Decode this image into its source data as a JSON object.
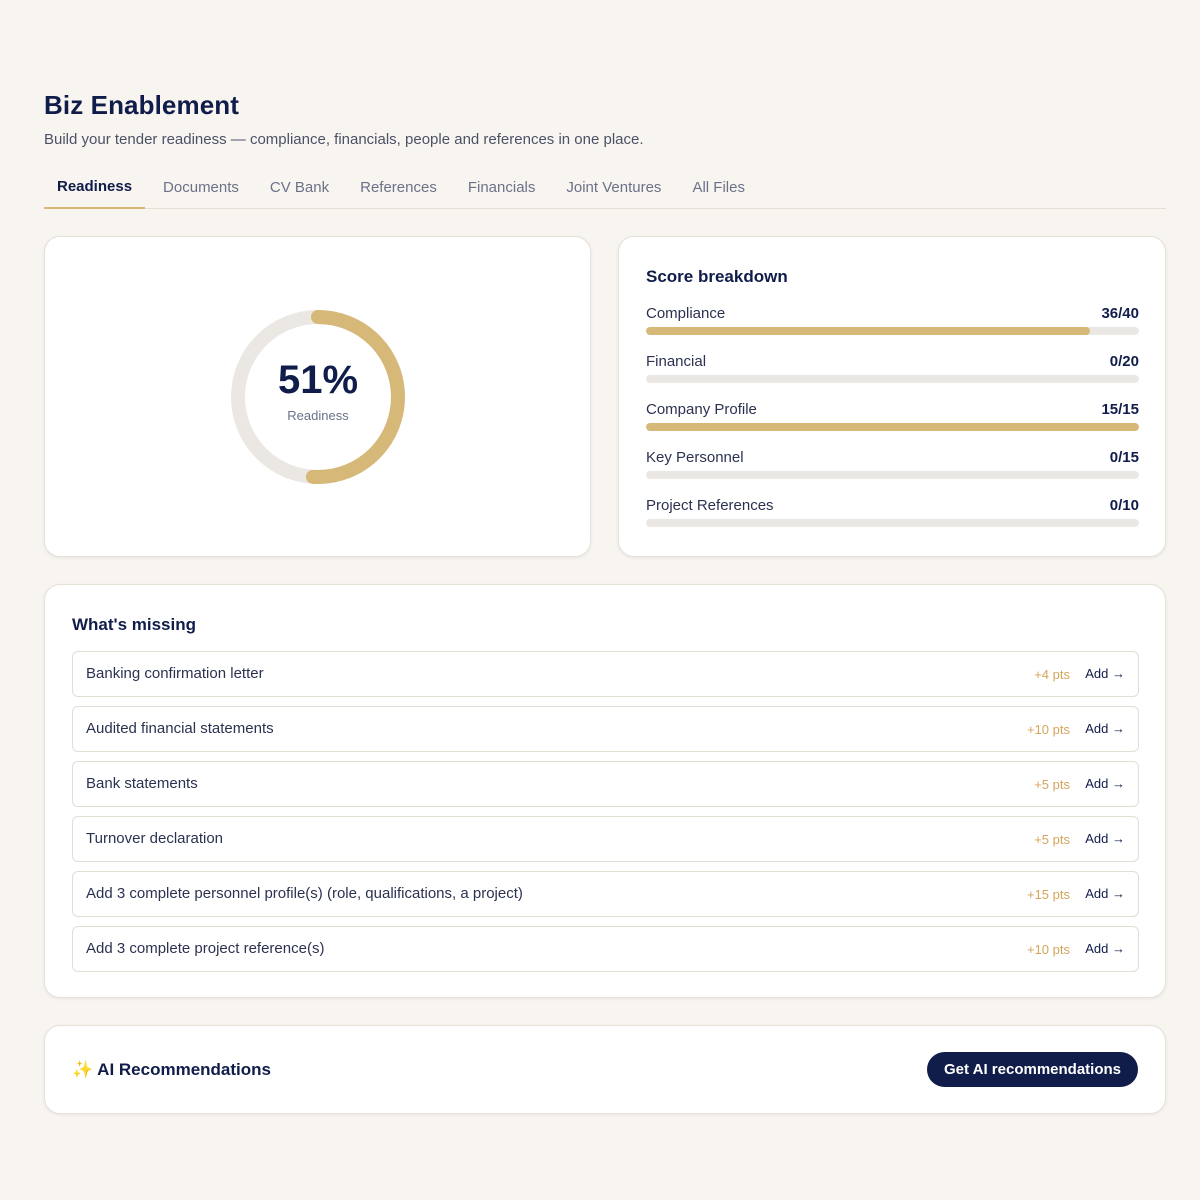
{
  "header": {
    "title": "Biz Enablement",
    "subtitle": "Build your tender readiness — compliance, financials, people and references in one place."
  },
  "tabs": [
    {
      "label": "Readiness",
      "active": true
    },
    {
      "label": "Documents",
      "active": false
    },
    {
      "label": "CV Bank",
      "active": false
    },
    {
      "label": "References",
      "active": false
    },
    {
      "label": "Financials",
      "active": false
    },
    {
      "label": "Joint Ventures",
      "active": false
    },
    {
      "label": "All Files",
      "active": false
    }
  ],
  "readiness": {
    "value_text": "51%",
    "percent": 51,
    "label": "Readiness"
  },
  "breakdown": {
    "title": "Score breakdown",
    "items": [
      {
        "label": "Compliance",
        "value_text": "36/40",
        "score": 36,
        "max": 40
      },
      {
        "label": "Financial",
        "value_text": "0/20",
        "score": 0,
        "max": 20
      },
      {
        "label": "Company Profile",
        "value_text": "15/15",
        "score": 15,
        "max": 15
      },
      {
        "label": "Key Personnel",
        "value_text": "0/15",
        "score": 0,
        "max": 15
      },
      {
        "label": "Project References",
        "value_text": "0/10",
        "score": 0,
        "max": 10
      }
    ]
  },
  "missing": {
    "title": "What's missing",
    "items": [
      {
        "label": "Banking confirmation letter",
        "points": "+4 pts",
        "action": "Add →"
      },
      {
        "label": "Audited financial statements",
        "points": "+10 pts",
        "action": "Add →"
      },
      {
        "label": "Bank statements",
        "points": "+5 pts",
        "action": "Add →"
      },
      {
        "label": "Turnover declaration",
        "points": "+5 pts",
        "action": "Add →"
      },
      {
        "label": "Add 3 complete personnel profile(s) (role, qualifications, a project)",
        "points": "+15 pts",
        "action": "Add →"
      },
      {
        "label": "Add 3 complete project reference(s)",
        "points": "+10 pts",
        "action": "Add →"
      }
    ]
  },
  "ai": {
    "icon": "sparkles-icon",
    "icon_glyph": "✨",
    "title": "AI Recommendations",
    "button_label": "Get AI recommendations"
  },
  "colors": {
    "background": "#f8f5f1",
    "navy": "#101c4a",
    "gold_accent": "#d6b879",
    "track": "#ebe7e2",
    "points": "#d4a55a"
  }
}
